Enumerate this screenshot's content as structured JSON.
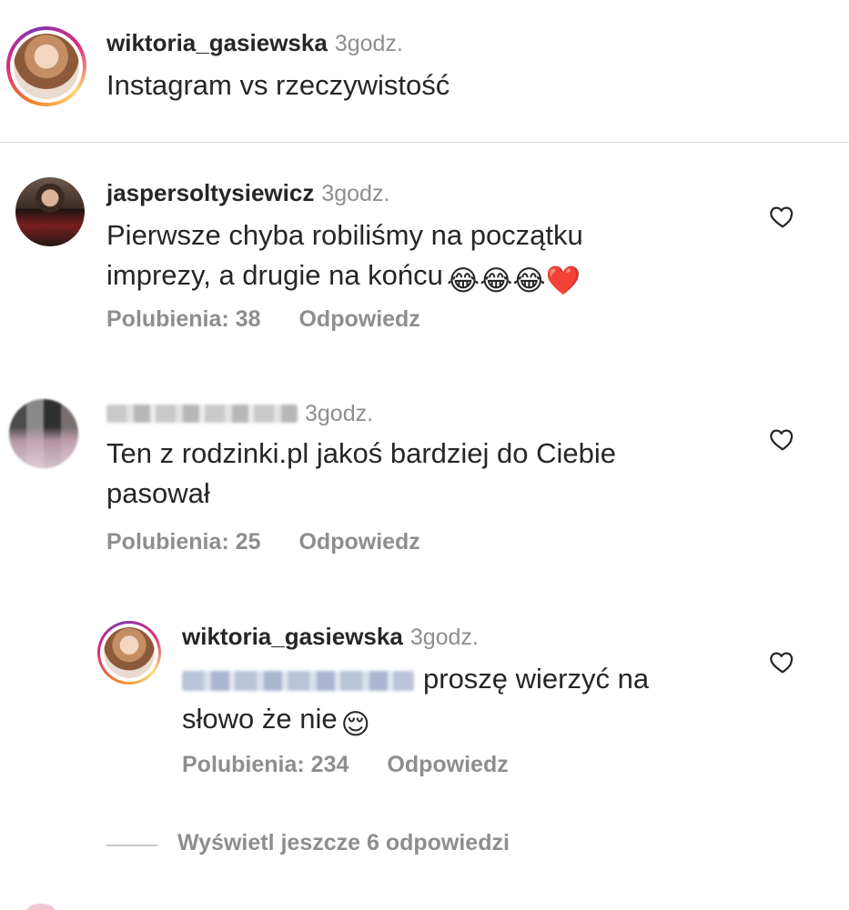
{
  "caption": {
    "username": "wiktoria_gasiewska",
    "time": "3godz.",
    "text": "Instagram vs rzeczywistość"
  },
  "comments": [
    {
      "username": "jaspersoltysiewicz",
      "time": "3godz.",
      "text_line1": "Pierwsze chyba robiliśmy na początku",
      "text_line2": "imprezy, a drugie na końcu",
      "emojis": "😂😂😂❤️",
      "likes": "Polubienia: 38",
      "reply": "Odpowiedz"
    },
    {
      "username_blurred": true,
      "time": "3godz.",
      "text_line1": "Ten z rodzinki.pl jakoś bardziej do Ciebie",
      "text_line2": "pasował",
      "likes": "Polubienia: 25",
      "reply": "Odpowiedz"
    }
  ],
  "reply": {
    "username": "wiktoria_gasiewska",
    "time": "3godz.",
    "mention_blurred": true,
    "text_line1": "proszę wierzyć na",
    "text_line2": "słowo że nie",
    "emoji": "😌",
    "likes": "Polubienia: 234",
    "reply": "Odpowiedz"
  },
  "view_more": "Wyświetl jeszcze 6 odpowiedzi",
  "icons": {
    "heart": "heart-outline-icon"
  },
  "colors": {
    "text": "#262626",
    "muted": "#8e8e8e",
    "divider": "#dbdbdb"
  }
}
